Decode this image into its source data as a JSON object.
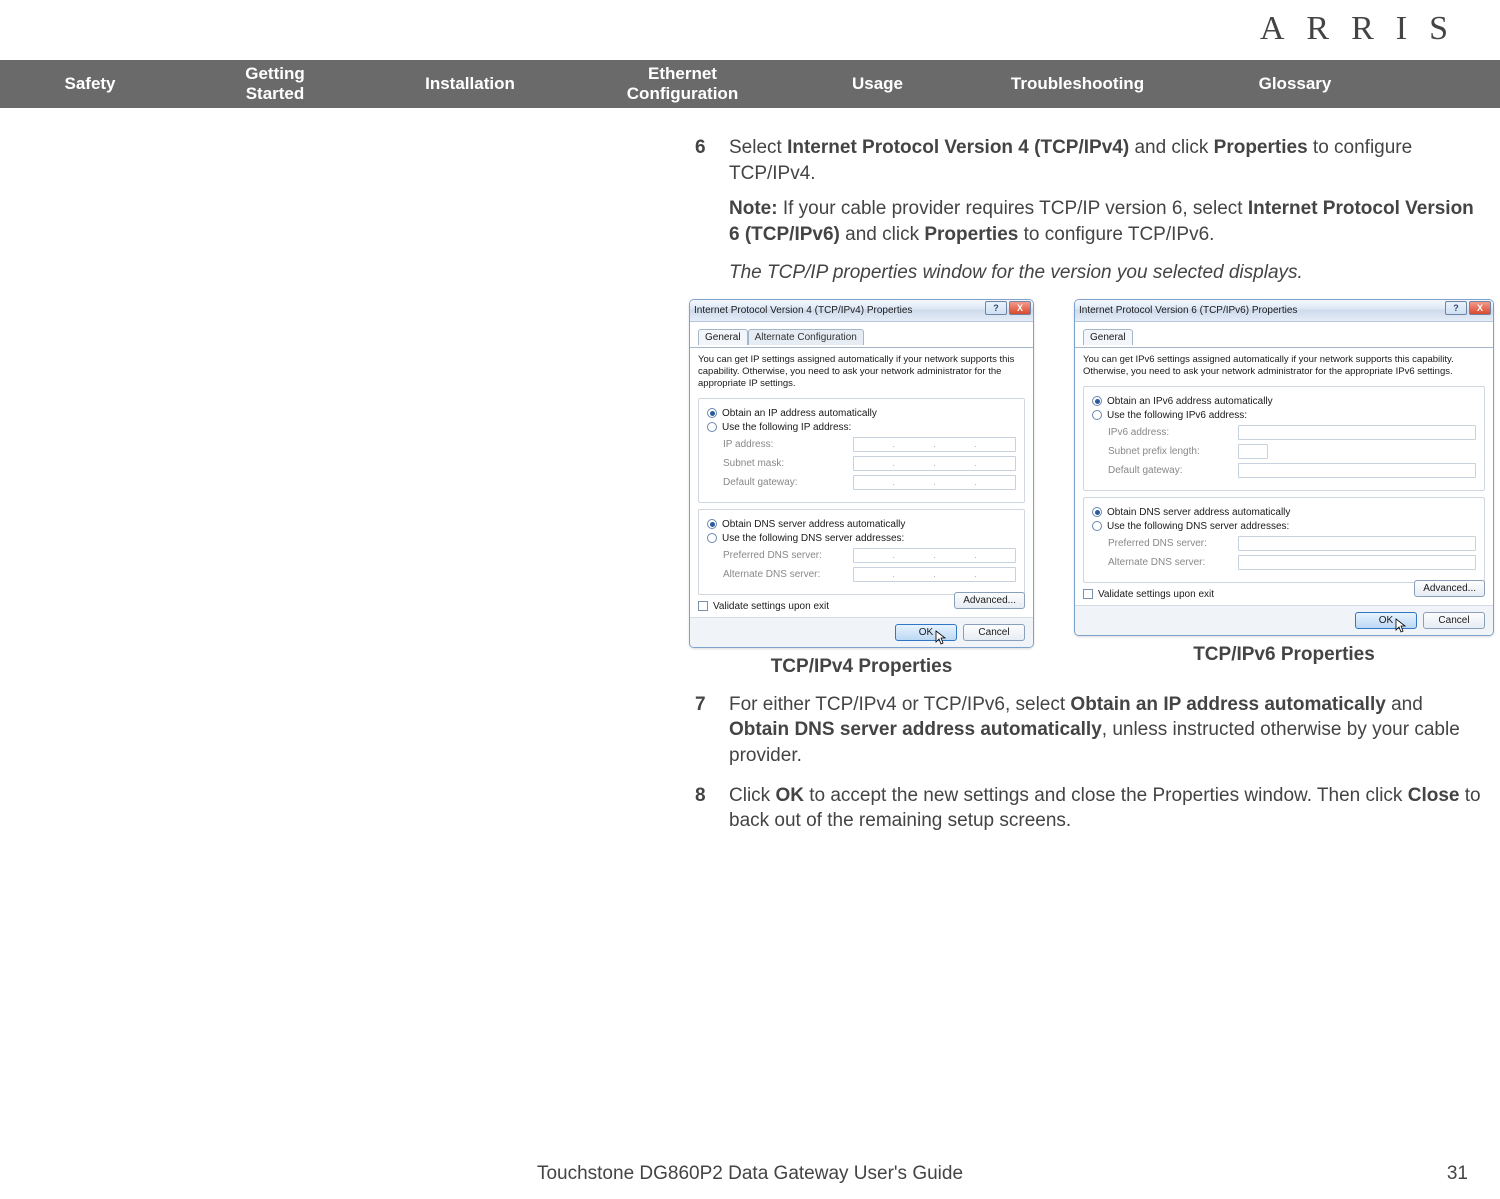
{
  "brand": "ARRIS",
  "nav": {
    "safety": "Safety",
    "getting1": "Getting",
    "getting2": "Started",
    "installation": "Installation",
    "ethernet1": "Ethernet",
    "ethernet2": "Configuration",
    "usage": "Usage",
    "troubleshooting": "Troubleshooting",
    "glossary": "Glossary"
  },
  "steps": {
    "s6": {
      "num": "6",
      "pre": "Select ",
      "b1": "Internet Protocol Version 4 (TCP/IPv4)",
      "mid": " and click ",
      "b2": "Properties",
      "post": " to configure TCP/IPv4.",
      "note_label": "Note:",
      "note_pre": " If your cable provider requires TCP/IP version 6, select ",
      "note_b1": "Internet Protocol Version 6 (TCP/IPv6)",
      "note_mid": " and click ",
      "note_b2": "Properties",
      "note_post": " to configure TCP/IPv6.",
      "italic": "The TCP/IP properties window for the version you selected displays."
    },
    "s7": {
      "num": "7",
      "pre": "For either TCP/IPv4 or TCP/IPv6, select ",
      "b1": "Obtain an IP address automatically",
      "mid": " and ",
      "b2": "Obtain DNS server address automatically",
      "post": ", unless instructed otherwise by your cable provider."
    },
    "s8": {
      "num": "8",
      "pre": "Click ",
      "b1": "OK",
      "mid": " to accept the new settings and close the Properties window. Then click ",
      "b2": "Close",
      "post": " to back out of the remaining setup screens."
    }
  },
  "captions": {
    "v4": "TCP/IPv4 Properties",
    "v6": "TCP/IPv6 Properties"
  },
  "dialog_v4": {
    "title": "Internet Protocol Version 4 (TCP/IPv4) Properties",
    "tab1": "General",
    "tab2": "Alternate Configuration",
    "desc": "You can get IP settings assigned automatically if your network supports this capability. Otherwise, you need to ask your network administrator for the appropriate IP settings.",
    "r_auto_ip": "Obtain an IP address automatically",
    "r_use_ip": "Use the following IP address:",
    "f_ip": "IP address:",
    "f_mask": "Subnet mask:",
    "f_gw": "Default gateway:",
    "r_auto_dns": "Obtain DNS server address automatically",
    "r_use_dns": "Use the following DNS server addresses:",
    "f_pref": "Preferred DNS server:",
    "f_alt": "Alternate DNS server:",
    "chk": "Validate settings upon exit",
    "advanced": "Advanced...",
    "ok": "OK",
    "cancel": "Cancel",
    "help": "?",
    "close": "X"
  },
  "dialog_v6": {
    "title": "Internet Protocol Version 6 (TCP/IPv6) Properties",
    "tab1": "General",
    "desc": "You can get IPv6 settings assigned automatically if your network supports this capability. Otherwise, you need to ask your network administrator for the appropriate IPv6 settings.",
    "r_auto_ip": "Obtain an IPv6 address automatically",
    "r_use_ip": "Use the following IPv6 address:",
    "f_ip": "IPv6 address:",
    "f_mask": "Subnet prefix length:",
    "f_gw": "Default gateway:",
    "r_auto_dns": "Obtain DNS server address automatically",
    "r_use_dns": "Use the following DNS server addresses:",
    "f_pref": "Preferred DNS server:",
    "f_alt": "Alternate DNS server:",
    "chk": "Validate settings upon exit",
    "advanced": "Advanced...",
    "ok": "OK",
    "cancel": "Cancel",
    "help": "?",
    "close": "X"
  },
  "footer": {
    "title": "Touchstone DG860P2 Data Gateway User's Guide",
    "page": "31"
  }
}
